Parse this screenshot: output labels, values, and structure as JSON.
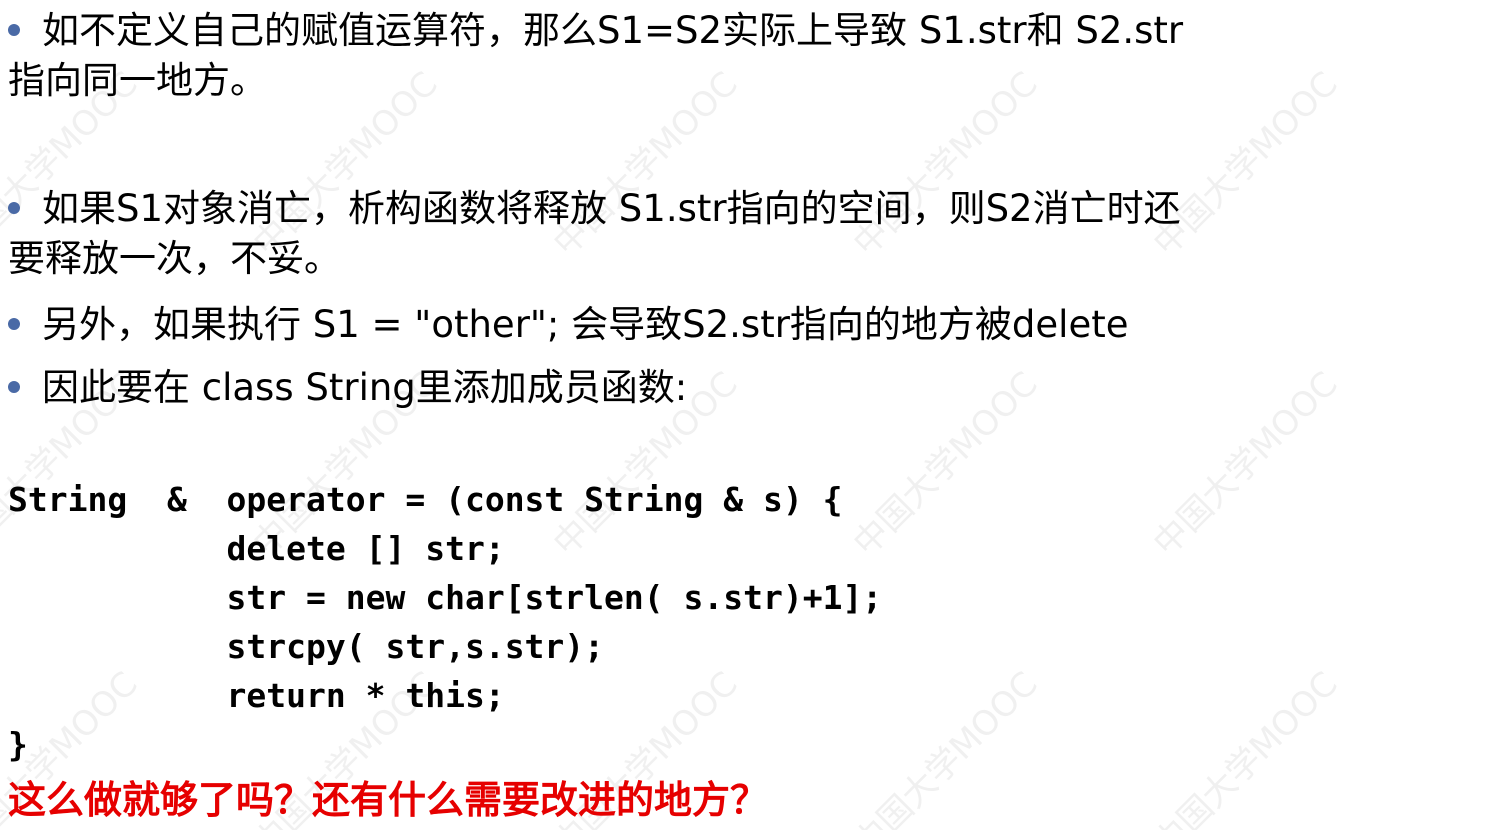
{
  "watermark": "中国大学MOOC",
  "paragraphs": [
    {
      "bullet": true,
      "lines": [
        "如不定义自己的赋值运算符，那么S1=S2实际上导致 S1.str和 S2.str",
        "指向同一地方。"
      ]
    },
    {
      "bullet": true,
      "lines": [
        "如果S1对象消亡，析构函数将释放 S1.str指向的空间，则S2消亡时还",
        "要释放一次，不妥。"
      ]
    },
    {
      "bullet": true,
      "lines": [
        "另外，如果执行 S1 = \"other\"; 会导致S2.str指向的地方被delete"
      ]
    },
    {
      "bullet": true,
      "lines": [
        "因此要在 class String里添加成员函数:"
      ]
    }
  ],
  "code_lines": [
    "String  &  operator = (const String & s) {",
    "           delete [] str;",
    "           str = new char[strlen( s.str)+1];",
    "           strcpy( str,s.str);",
    "           return * this;",
    "}"
  ],
  "question": "这么做就够了吗？还有什么需要改进的地方？"
}
